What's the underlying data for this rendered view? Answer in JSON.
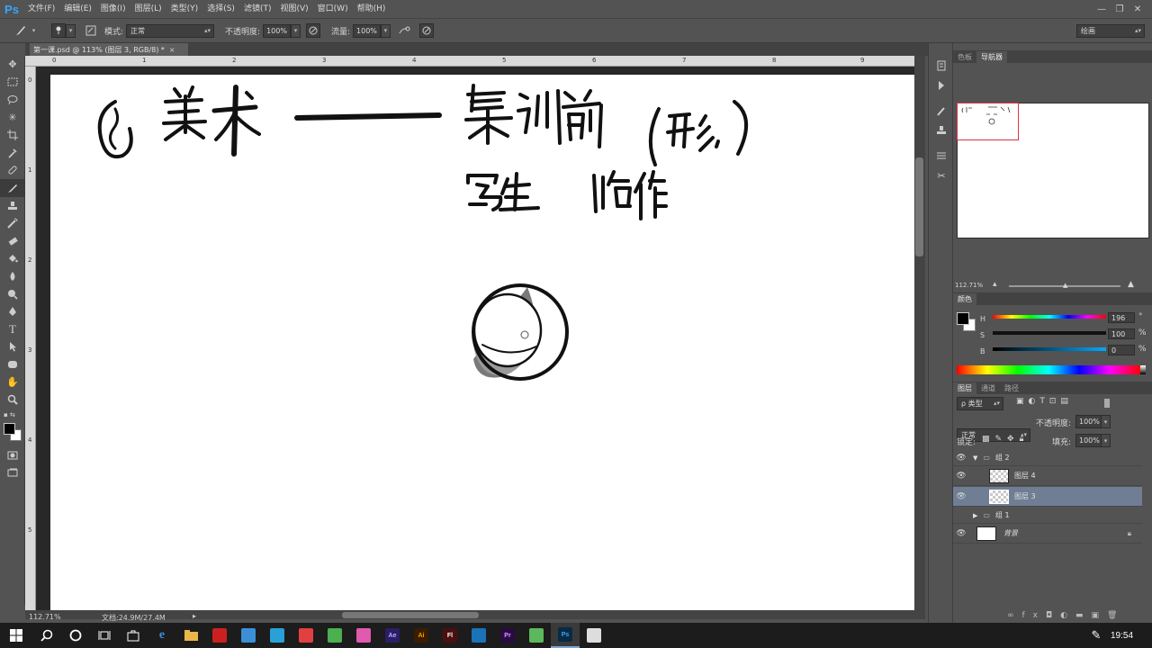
{
  "app": {
    "logo": "Ps"
  },
  "menu": [
    "文件(F)",
    "编辑(E)",
    "图像(I)",
    "图层(L)",
    "类型(Y)",
    "选择(S)",
    "滤镜(T)",
    "视图(V)",
    "窗口(W)",
    "帮助(H)"
  ],
  "window_controls": {
    "minimize": "—",
    "restore": "❐",
    "close": "✕"
  },
  "options": {
    "mode_label": "模式:",
    "mode_value": "正常",
    "opacity_label": "不透明度:",
    "opacity_value": "100%",
    "flow_label": "流量:",
    "flow_value": "100%",
    "workspace": "绘画"
  },
  "document": {
    "tab_title": "第一课.psd @ 113% (图层 3, RGB/8) *",
    "tab_close": "×",
    "ruler_top_labels": [
      "0",
      "1",
      "2",
      "3",
      "4",
      "5",
      "6",
      "7",
      "8",
      "9"
    ],
    "ruler_left_labels": [
      "0",
      "1",
      "2",
      "3",
      "4",
      "5"
    ]
  },
  "status": {
    "zoom": "112.71%",
    "doc_info": "文档:24.9M/27.4M"
  },
  "navigator": {
    "tabs": [
      "色板",
      "导航器"
    ],
    "zoom": "112.71%"
  },
  "color_panel": {
    "title": "颜色",
    "h_label": "H",
    "h_value": "196",
    "s_label": "S",
    "s_value": "100",
    "b_label": "B",
    "b_value": "0",
    "h_unit": "°",
    "s_unit": "%",
    "b_unit": "%"
  },
  "layers_panel": {
    "tabs": [
      "图层",
      "通道",
      "路径"
    ],
    "filter_label": "ρ 类型",
    "blend_mode": "正常",
    "opacity_label": "不透明度:",
    "opacity_value": "100%",
    "lock_label": "锁定:",
    "fill_label": "填充:",
    "fill_value": "100%",
    "layers": [
      {
        "name": "组 2",
        "type": "group-open"
      },
      {
        "name": "图层 4",
        "type": "layer"
      },
      {
        "name": "图层 3",
        "type": "layer",
        "selected": true
      },
      {
        "name": "组 1",
        "type": "group-closed"
      },
      {
        "name": "背景",
        "type": "background"
      }
    ]
  },
  "taskbar": {
    "time": "19:54",
    "apps": [
      {
        "label": "",
        "color": "#cc2020"
      },
      {
        "label": "",
        "color": "#3a8fd6"
      },
      {
        "label": "",
        "color": "#2aa0d8"
      },
      {
        "label": "",
        "color": "#e24040"
      },
      {
        "label": "",
        "color": "#4caf50"
      },
      {
        "label": "",
        "color": "#e05ab0"
      },
      {
        "label": "Ae",
        "color": "#2a1f66"
      },
      {
        "label": "Ai",
        "color": "#3a1d00"
      },
      {
        "label": "Fl",
        "color": "#4a0f0f"
      },
      {
        "label": "",
        "color": "#1a73b8"
      },
      {
        "label": "Pr",
        "color": "#2a0a44"
      },
      {
        "label": "",
        "color": "#5cb85c"
      },
      {
        "label": "Ps",
        "color": "#0a2a44"
      },
      {
        "label": "",
        "color": "#dddddd"
      }
    ]
  }
}
